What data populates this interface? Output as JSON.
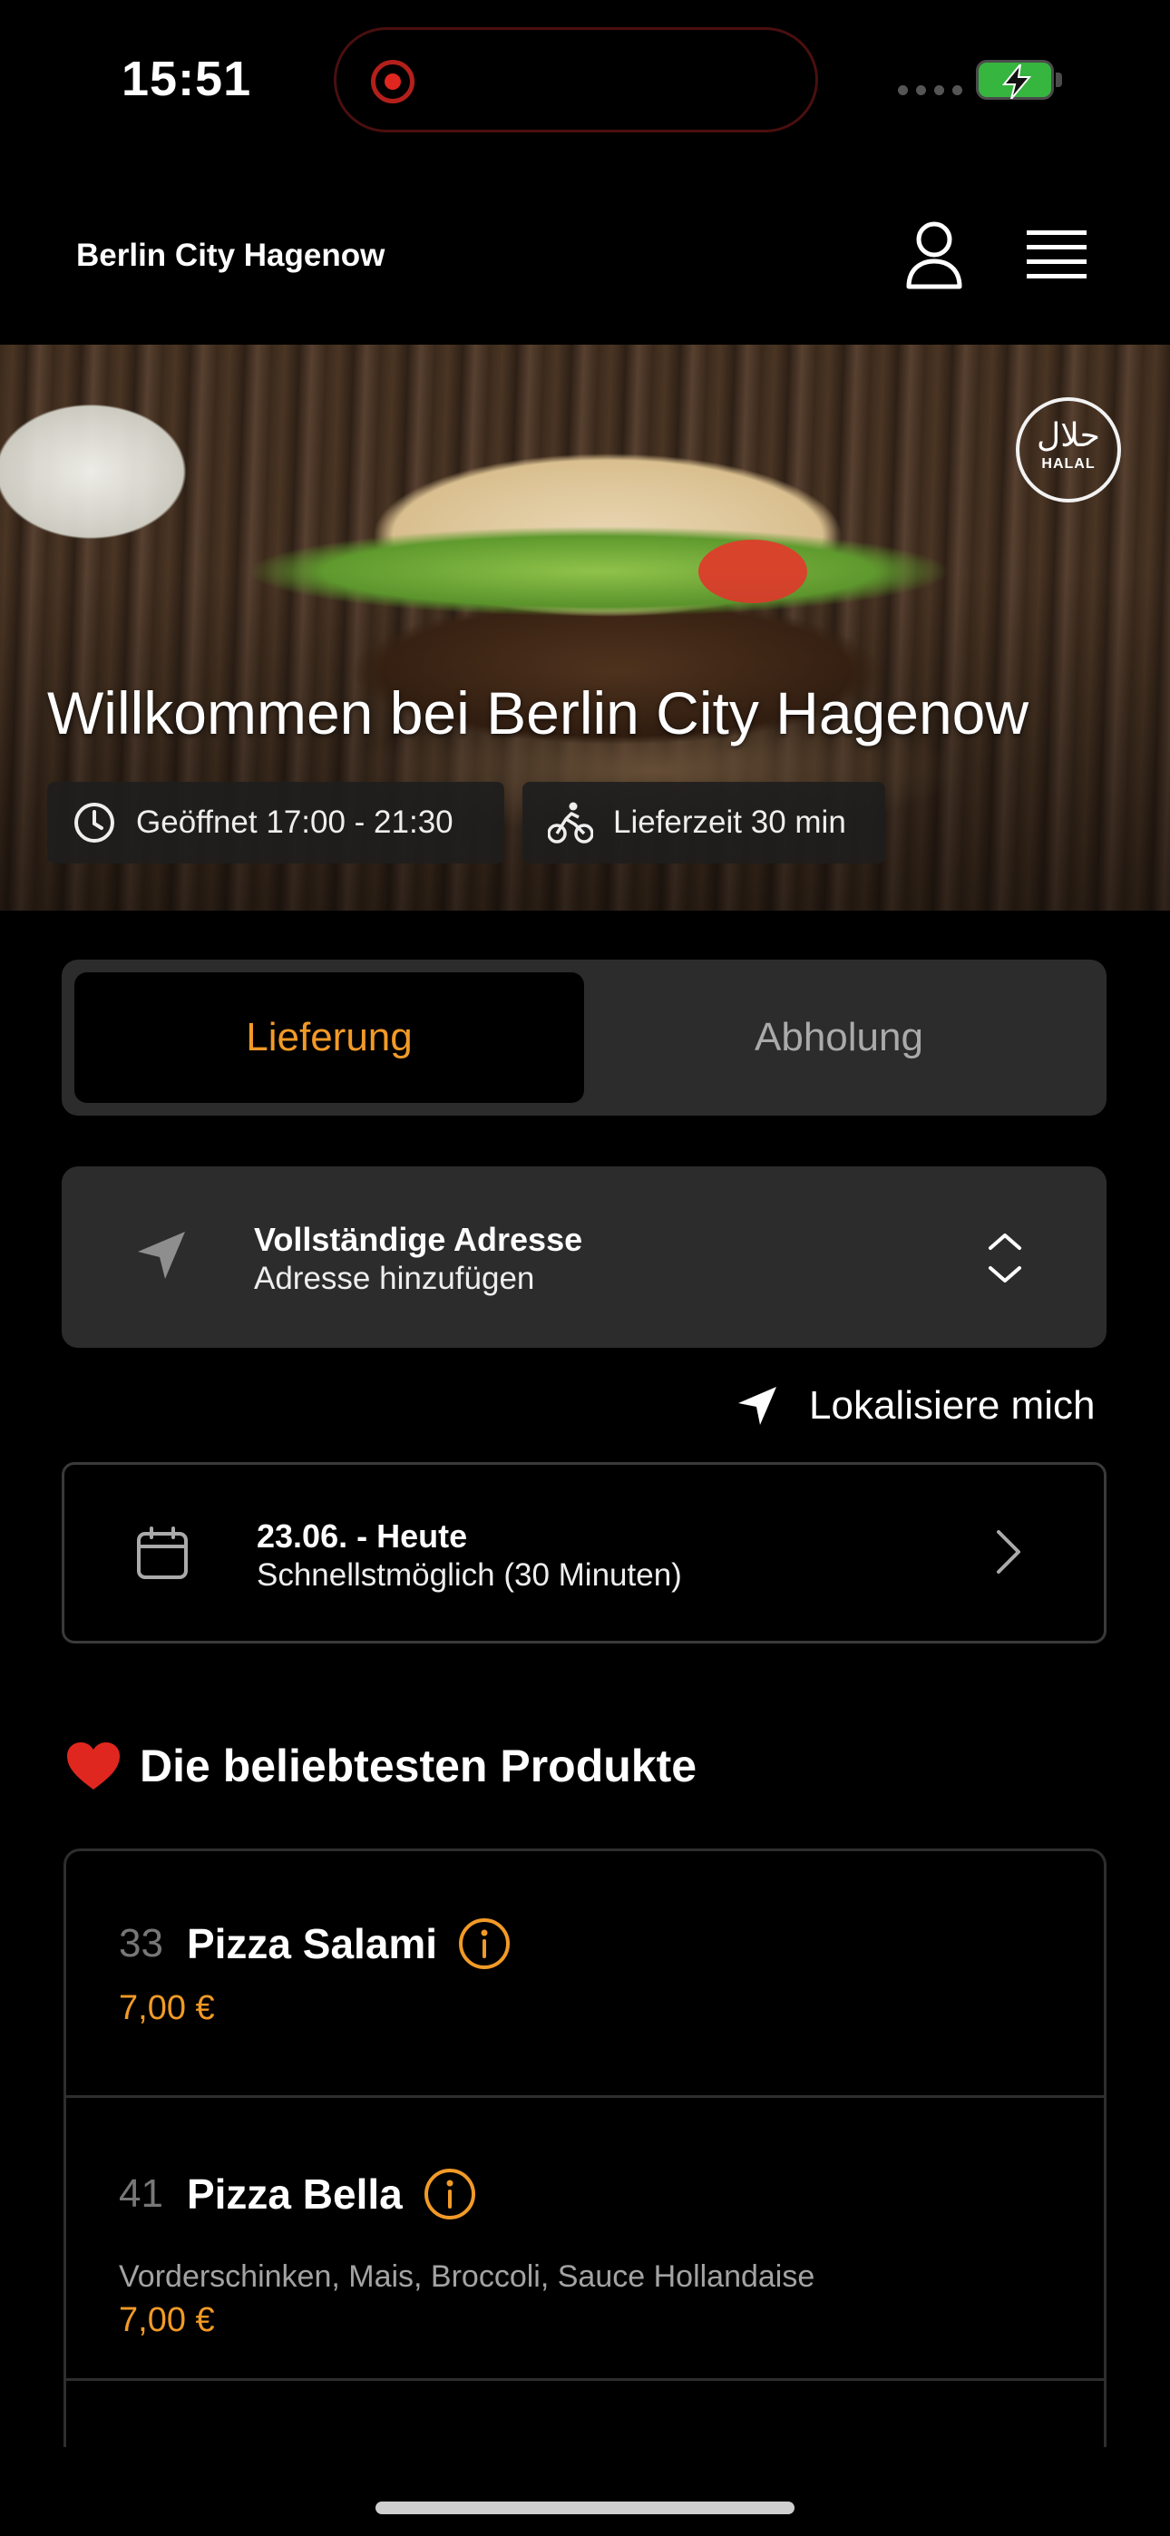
{
  "status_bar": {
    "time": "15:51"
  },
  "header": {
    "brand": "Berlin City Hagenow"
  },
  "hero": {
    "title": "Willkommen bei Berlin City Hagenow",
    "open_hours": "Geöffnet 17:00 - 21:30",
    "delivery_time": "Lieferzeit 30 min",
    "badge_arabic": "حلال",
    "badge_text": "HALAL"
  },
  "mode": {
    "delivery": "Lieferung",
    "pickup": "Abholung",
    "selected": "delivery"
  },
  "address": {
    "title": "Vollständige Adresse",
    "subtitle": "Adresse hinzufügen"
  },
  "locate_label": "Lokalisiere mich",
  "schedule": {
    "date": "23.06. - Heute",
    "time": "Schnellstmöglich (30 Minuten)"
  },
  "popular": {
    "title": "Die beliebtesten Produkte",
    "products": [
      {
        "number": "33",
        "name": "Pizza Salami",
        "description": "",
        "price": "7,00 €"
      },
      {
        "number": "41",
        "name": "Pizza Bella",
        "description": "Vorderschinken, Mais, Broccoli, Sauce Hollandaise",
        "price": "7,00 €"
      }
    ]
  },
  "colors": {
    "accent": "#f29a27",
    "surface": "#2c2c2c",
    "background": "#000000"
  },
  "icons": [
    "record-icon",
    "battery-icon",
    "user-icon",
    "menu-icon",
    "clock-icon",
    "bike-icon",
    "location-arrow-icon",
    "updown-chevron-icon",
    "calendar-icon",
    "chevron-right-icon",
    "heart-icon",
    "info-icon"
  ]
}
